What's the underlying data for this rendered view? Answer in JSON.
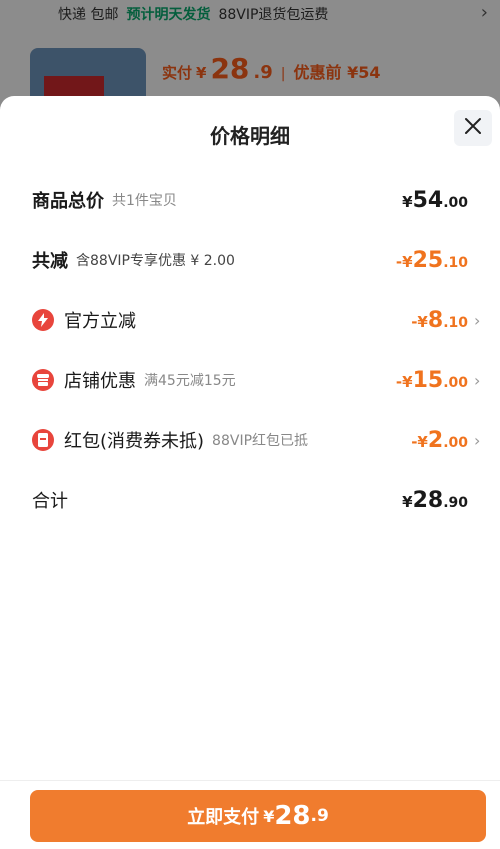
{
  "background": {
    "shipping_label": "快递 包邮",
    "shipping_badge": "预计明天发货",
    "shipping_vip": "88VIP退货包运费",
    "paid_label": "实付",
    "paid_symbol": "¥",
    "paid_int": "28",
    "paid_dec": ".9",
    "separator": "|",
    "original_label": "优惠前 ¥54"
  },
  "sheet": {
    "title": "价格明细",
    "close_icon": "close-icon",
    "rows": [
      {
        "name": "商品总价",
        "sub": "共1件宝贝",
        "symbol": "¥",
        "int": "54",
        "dec": ".00",
        "color": "#1a1a1a"
      },
      {
        "name": "共减",
        "sub": "含88VIP专享优惠 ¥ 2.00",
        "symbol": "-¥",
        "int": "25",
        "dec": ".10",
        "color": "#f0731e"
      },
      {
        "name": "官方立减",
        "sub": "",
        "symbol": "-¥",
        "int": "8",
        "dec": ".10",
        "icon": "lightning-icon",
        "color": "#f0731e"
      },
      {
        "name": "店铺优惠",
        "sub": "满45元减15元",
        "symbol": "-¥",
        "int": "15",
        "dec": ".00",
        "icon": "store-icon",
        "color": "#f0731e"
      },
      {
        "name": "红包(消费券未抵)",
        "sub": "88VIP红包已抵",
        "symbol": "-¥",
        "int": "2",
        "dec": ".00",
        "icon": "red-packet-icon",
        "color": "#f0731e"
      },
      {
        "name": "合计",
        "sub": "",
        "symbol": "¥",
        "int": "28",
        "dec": ".90",
        "color": "#1a1a1a"
      }
    ],
    "chevron": "›"
  },
  "pay_button": {
    "label": "立即支付",
    "symbol": "¥",
    "int": "28",
    "dec": ".9",
    "color": "#f07c2e"
  }
}
